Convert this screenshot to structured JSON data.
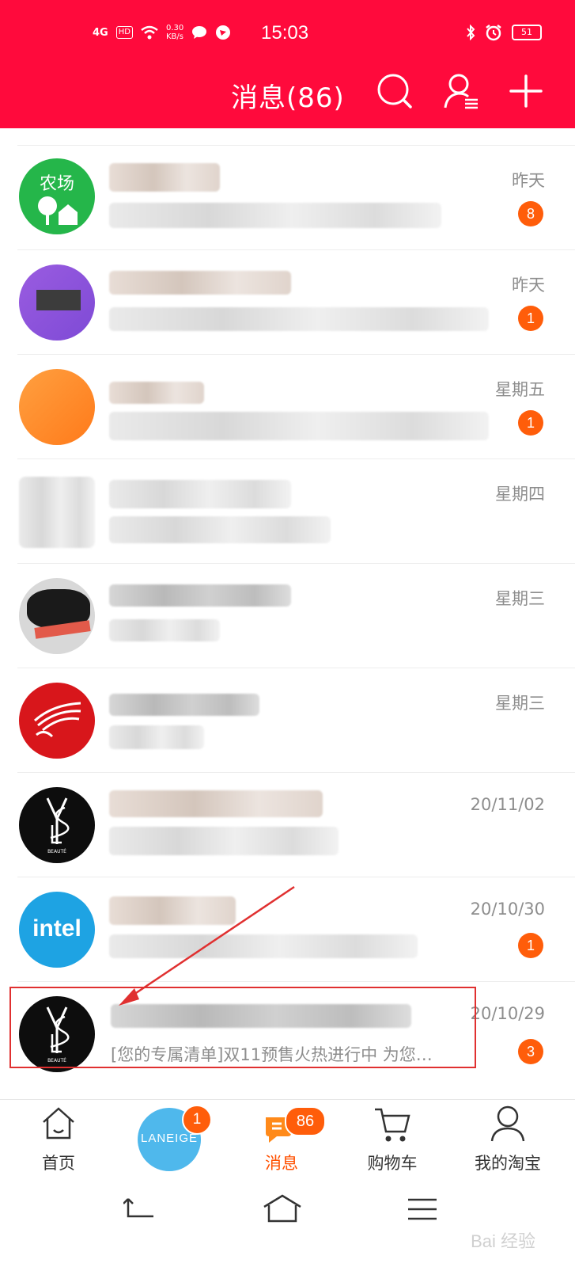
{
  "status_bar": {
    "network": "4G",
    "hd": "HD",
    "speed_top": "0.30",
    "speed_bottom": "KB/s",
    "time": "15:03",
    "battery": "51"
  },
  "header": {
    "title": "消息(86)"
  },
  "conversations": [
    {
      "avatar_label": "农场",
      "date": "昨天",
      "unread": "8",
      "preview": ""
    },
    {
      "date": "昨天",
      "unread": "1",
      "preview": ""
    },
    {
      "date": "星期五",
      "unread": "1",
      "preview": ""
    },
    {
      "date": "星期四",
      "unread": "",
      "preview": ""
    },
    {
      "date": "星期三",
      "unread": "",
      "preview": ""
    },
    {
      "date": "星期三",
      "unread": "",
      "preview": ""
    },
    {
      "avatar_label": "BEAUTÉ",
      "date": "20/11/02",
      "unread": "",
      "preview": ""
    },
    {
      "avatar_label": "intel",
      "date": "20/10/30",
      "unread": "1",
      "preview": ""
    },
    {
      "avatar_label": "BEAUTÉ",
      "date": "20/10/29",
      "unread": "3",
      "preview": "[您的专属清单]双11预售火热进行中 为您…"
    }
  ],
  "tabbar": {
    "home": "首页",
    "laneige": "LANEIGE",
    "laneige_badge": "1",
    "messages": "消息",
    "messages_badge": "86",
    "cart": "购物车",
    "me": "我的淘宝"
  },
  "watermark": "Bai 经验",
  "colors": {
    "header": "#ff0a3c",
    "badge": "#ff5d0a",
    "active_tab": "#ff5000",
    "highlight": "#e03030"
  }
}
